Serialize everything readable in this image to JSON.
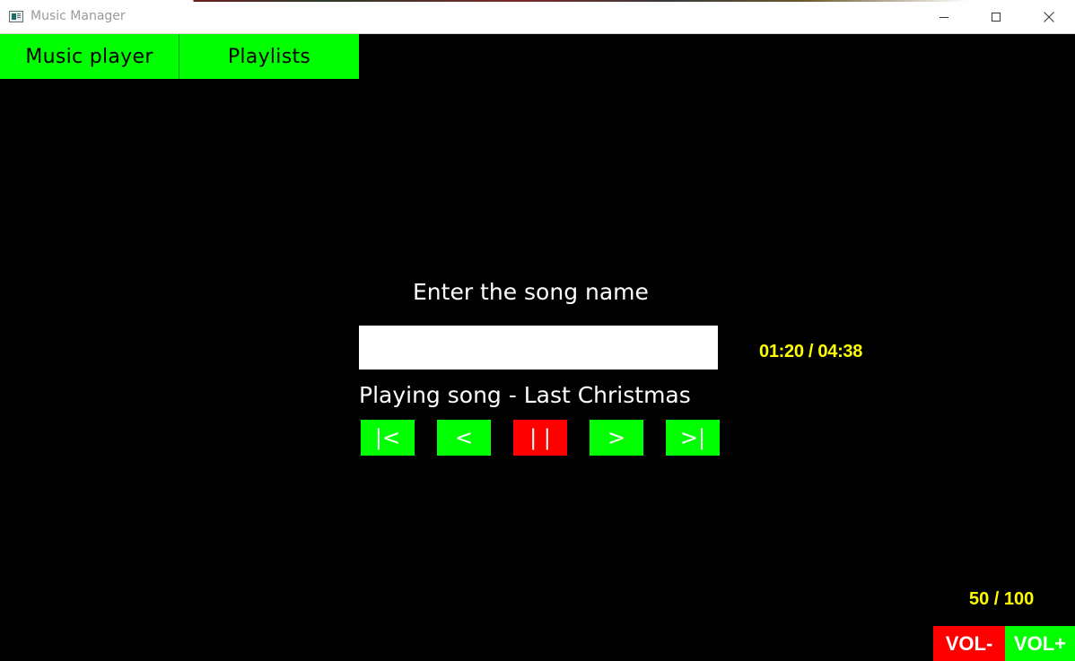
{
  "window": {
    "title": "Music Manager",
    "icon": "app-window-icon",
    "controls": [
      "minimize-icon",
      "maximize-icon",
      "close-icon"
    ]
  },
  "tabs": [
    {
      "label": "Music player",
      "color": "#00ff00"
    },
    {
      "label": "Playlists",
      "color": "#00ff00"
    }
  ],
  "search": {
    "label": "Enter the song name",
    "value": "",
    "placeholder": ""
  },
  "player": {
    "time": "01:20 / 04:38",
    "now_playing": "Playing song - Last Christmas",
    "controls": [
      {
        "label": "|<",
        "name": "skip-to-start",
        "color": "#00ff00"
      },
      {
        "label": "<",
        "name": "previous",
        "color": "#00ff00"
      },
      {
        "label": "| |",
        "name": "pause",
        "color": "#ff0000"
      },
      {
        "label": ">",
        "name": "next",
        "color": "#00ff00"
      },
      {
        "label": ">|",
        "name": "skip-to-end",
        "color": "#00ff00"
      }
    ]
  },
  "volume": {
    "level": "50 / 100",
    "down_label": "VOL-",
    "up_label": "VOL+",
    "down_color": "#ff0000",
    "up_color": "#00ff00"
  },
  "colors": {
    "background": "#000000",
    "accent_green": "#00ff00",
    "accent_red": "#ff0000",
    "info_yellow": "#ffff00"
  }
}
